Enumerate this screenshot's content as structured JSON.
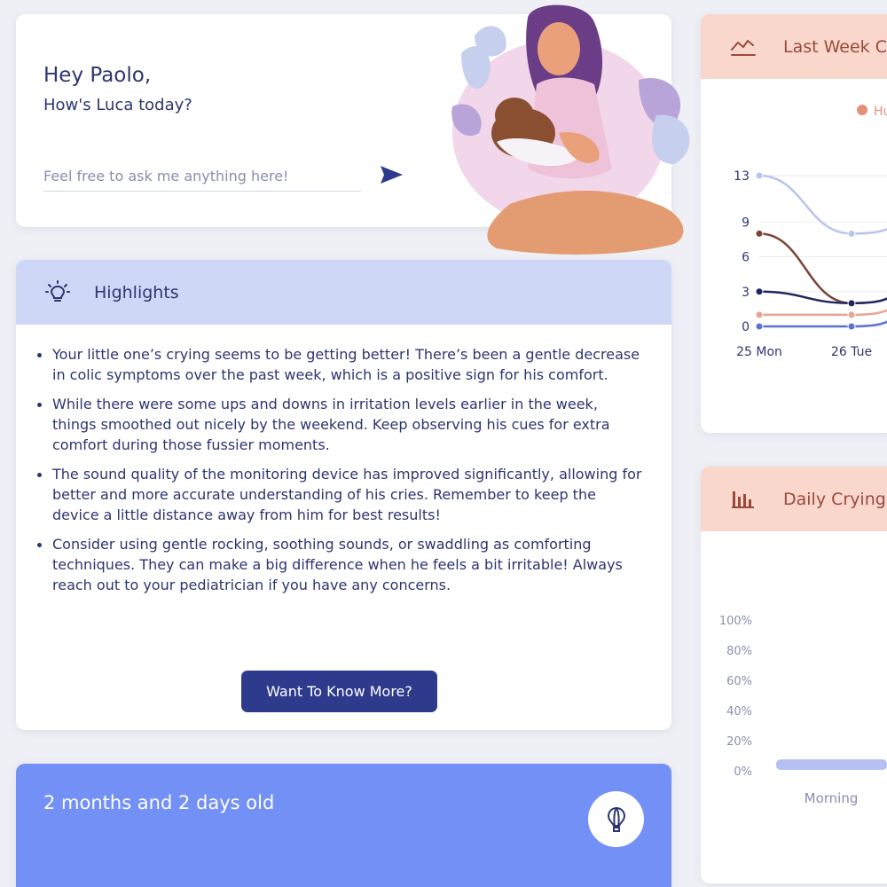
{
  "greeting": {
    "hello": "Hey Paolo,",
    "question": "How's Luca today?",
    "input_placeholder": "Feel free to ask me anything here!"
  },
  "highlights": {
    "title": "Highlights",
    "items": [
      "Your little one’s crying seems to be getting better! There’s been a gentle decrease in colic symptoms over the past week, which is a positive sign for his comfort.",
      "While there were some ups and downs in irritation levels earlier in the week, things smoothed out nicely by the weekend. Keep observing his cues for extra comfort during those fussier moments.",
      "The sound quality of the monitoring device has improved significantly, allowing for better and more accurate understanding of his cries. Remember to keep the device a little distance away from him for best results!",
      "Consider using gentle rocking, soothing sounds, or swaddling as comforting techniques. They can make a big difference when he feels a bit irritable! Always reach out to your pediatrician if you have any concerns."
    ],
    "button_label": "Want To Know More?"
  },
  "age": {
    "label": "2 months and 2 days old"
  },
  "trend_card": {
    "title": "Last Week C",
    "legend_visible": "Hu"
  },
  "crying_card": {
    "title": "Daily Crying"
  },
  "colors": {
    "primary": "#2e3b8c",
    "highlight_header": "#cfd7f7",
    "age_card": "#7390f6",
    "chart_header": "#f9d7cc"
  },
  "chart_data": [
    {
      "type": "line",
      "title": "Last Week C",
      "categories": [
        "25 Mon",
        "26 Tue"
      ],
      "y_ticks": [
        "0",
        "3",
        "6",
        "9",
        "13"
      ],
      "ylim": [
        0,
        13
      ],
      "legend": [
        "Hu"
      ],
      "series": [
        {
          "color": "#b9c3ef",
          "values": [
            13,
            8
          ]
        },
        {
          "color": "#7a4535",
          "values": [
            8,
            2
          ]
        },
        {
          "color": "#1f2660",
          "values": [
            3,
            2
          ]
        },
        {
          "color": "#e9a48f",
          "values": [
            1,
            1
          ]
        },
        {
          "color": "#5b74d3",
          "values": [
            0,
            0
          ]
        }
      ]
    },
    {
      "type": "bar",
      "title": "Daily Crying",
      "categories": [
        "Morning"
      ],
      "y_ticks": [
        "0%",
        "20%",
        "40%",
        "60%",
        "80%",
        "100%"
      ],
      "ylim": [
        0,
        100
      ],
      "values": [
        7
      ],
      "color": "#b5c1f3"
    }
  ]
}
